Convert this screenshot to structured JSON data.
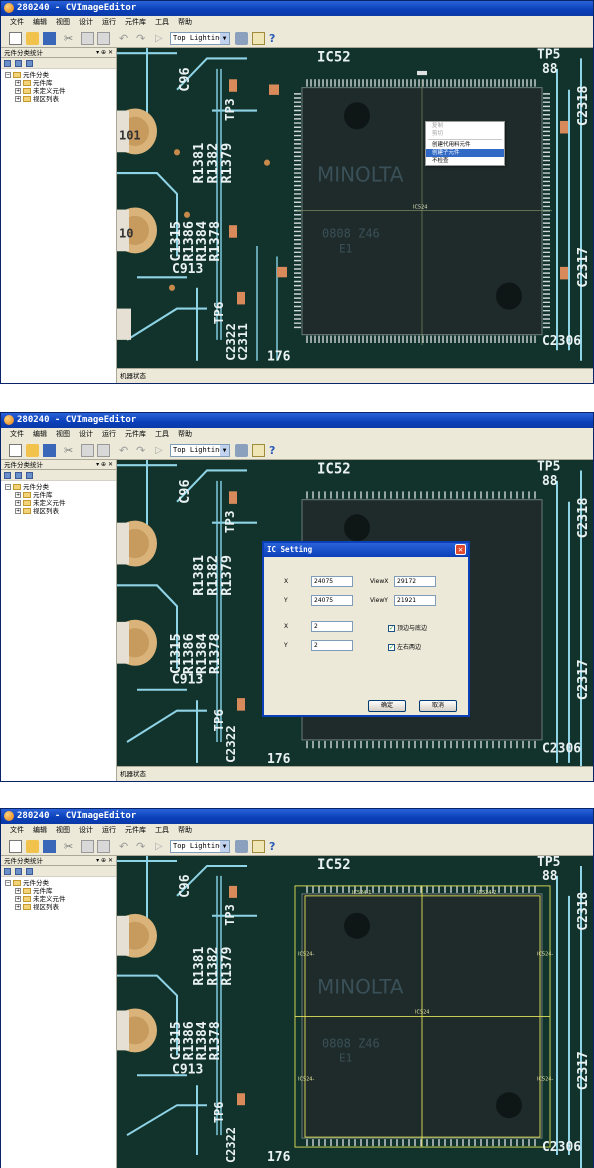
{
  "app": {
    "title": "280240 - CVImageEditor",
    "menus": [
      "文件",
      "编辑",
      "视图",
      "设计",
      "运行",
      "元件库",
      "工具",
      "帮助"
    ],
    "layer_select": "Top Lighting",
    "panel_title": "元件分类统计",
    "panel_controls": "▾ ⊕ ✕",
    "tree": {
      "root": "元件分类",
      "children": [
        "元件库",
        "未定义元件",
        "视区列表"
      ]
    },
    "status_text": "机器状态"
  },
  "context_menu": {
    "items": [
      {
        "label": "复制",
        "disabled": true
      },
      {
        "label": "剪切",
        "disabled": true
      },
      {
        "label": "创建代用料元件",
        "disabled": false
      },
      {
        "label": "创建子元件",
        "disabled": false,
        "selected": true
      },
      {
        "label": "不检查",
        "disabled": false
      }
    ],
    "center_label": "IC524"
  },
  "ic_dialog": {
    "title": "IC Setting",
    "close": "✕",
    "x_label": "X",
    "y_label": "Y",
    "x_value": "24075",
    "y_value": "24075",
    "viewx_label": "ViewX",
    "viewy_label": "ViewY",
    "viewx_value": "29172",
    "viewy_value": "21921",
    "x2_label": "X",
    "y2_label": "Y",
    "x2_value": "2",
    "y2_value": "2",
    "check1": "顶边与底边",
    "check2": "左右两边",
    "ok": "确定",
    "cancel": "取消"
  },
  "result_view": {
    "center": "IC524",
    "top_left": "IC524-1",
    "top_right": "IC524-2",
    "left": "IC524-",
    "right": "IC524-",
    "bottom_left": "IC524-",
    "bottom_right": "IC524-"
  },
  "pcb_labels": {
    "ic52": "IC52",
    "tp5": "TP5",
    "n88": "88",
    "c2318": "C2318",
    "c96": "C96",
    "tp3": "TP3",
    "tp6": "TP6",
    "r1381": "R1381",
    "r1382": "R1382",
    "r1379": "R1379",
    "r1386": "R1386",
    "r1384": "R1384",
    "r1378": "R1378",
    "c1315": "C1315",
    "c913": "C913",
    "c2322": "C2322",
    "c2311": "C2311",
    "n176": "176",
    "c2317": "C2317",
    "c2306": "C2306",
    "minolta": "MINOLTA",
    "chip_code": "0808 Z46",
    "chip_e1": "E1",
    "cap_101": "101",
    "cap_10": "10"
  }
}
